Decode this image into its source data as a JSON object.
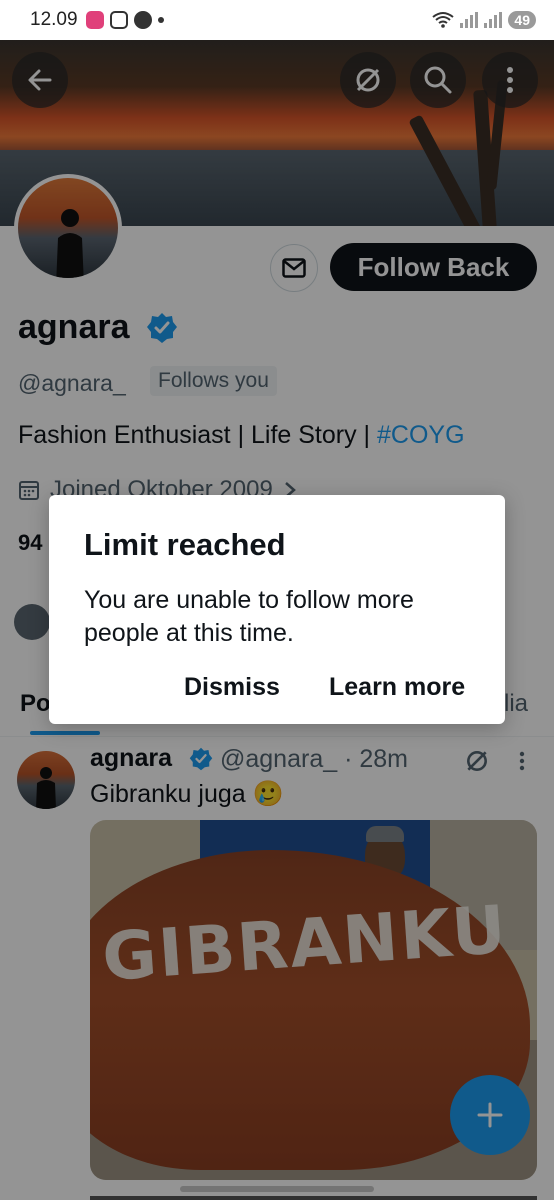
{
  "status_bar": {
    "time": "12.09",
    "battery": "49"
  },
  "profile": {
    "display_name": "agnara",
    "handle": "@agnara_",
    "follows_you": "Follows you",
    "follow_button": "Follow Back",
    "bio_text": "Fashion Enthusiast | Life Story | ",
    "bio_hashtag": "#COYG",
    "joined": "Joined Oktober 2009",
    "stat_peek": "94",
    "tab_left_peek": "Po",
    "tab_right_peek": "lia"
  },
  "tweet": {
    "name": "agnara",
    "handle_time": "@agnara_ · 28m",
    "text": "Gibranku juga 🥲",
    "image_caption": "GIBRANKU"
  },
  "dialog": {
    "title": "Limit reached",
    "body": "You are unable to follow more people at this time.",
    "dismiss": "Dismiss",
    "learn_more": "Learn more"
  },
  "colors": {
    "accent": "#1d9bf0",
    "text": "#0f1419",
    "secondary": "#536471"
  }
}
